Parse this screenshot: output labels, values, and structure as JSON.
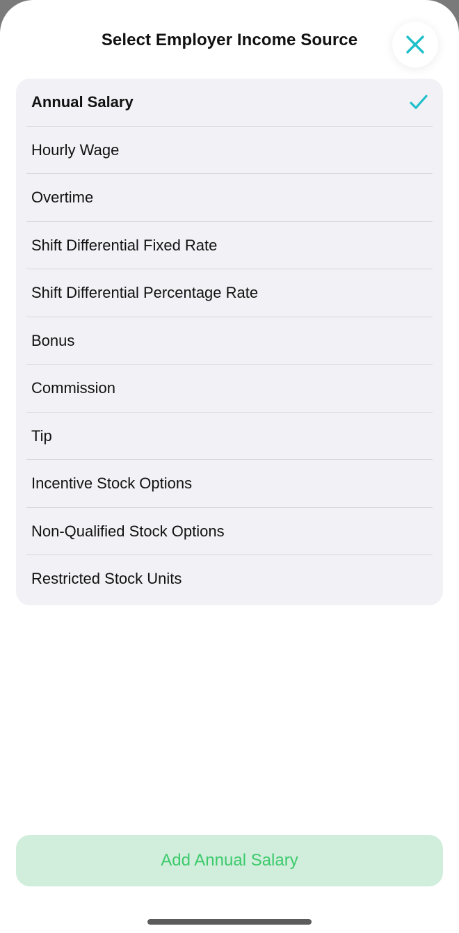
{
  "header": {
    "title": "Select Employer Income Source",
    "close_icon": "close-x-icon"
  },
  "options": [
    {
      "label": "Annual Salary",
      "selected": true
    },
    {
      "label": "Hourly Wage",
      "selected": false
    },
    {
      "label": "Overtime",
      "selected": false
    },
    {
      "label": "Shift Differential Fixed Rate",
      "selected": false
    },
    {
      "label": "Shift Differential Percentage Rate",
      "selected": false
    },
    {
      "label": "Bonus",
      "selected": false
    },
    {
      "label": "Commission",
      "selected": false
    },
    {
      "label": "Tip",
      "selected": false
    },
    {
      "label": "Incentive Stock Options",
      "selected": false
    },
    {
      "label": "Non-Qualified Stock Options",
      "selected": false
    },
    {
      "label": "Restricted Stock Units",
      "selected": false
    }
  ],
  "action": {
    "add_label": "Add Annual Salary"
  },
  "colors": {
    "accent": "#1fbfc9",
    "action_text": "#3dca6c",
    "action_bg": "#d0eedb",
    "list_bg": "#f1f1f6"
  }
}
